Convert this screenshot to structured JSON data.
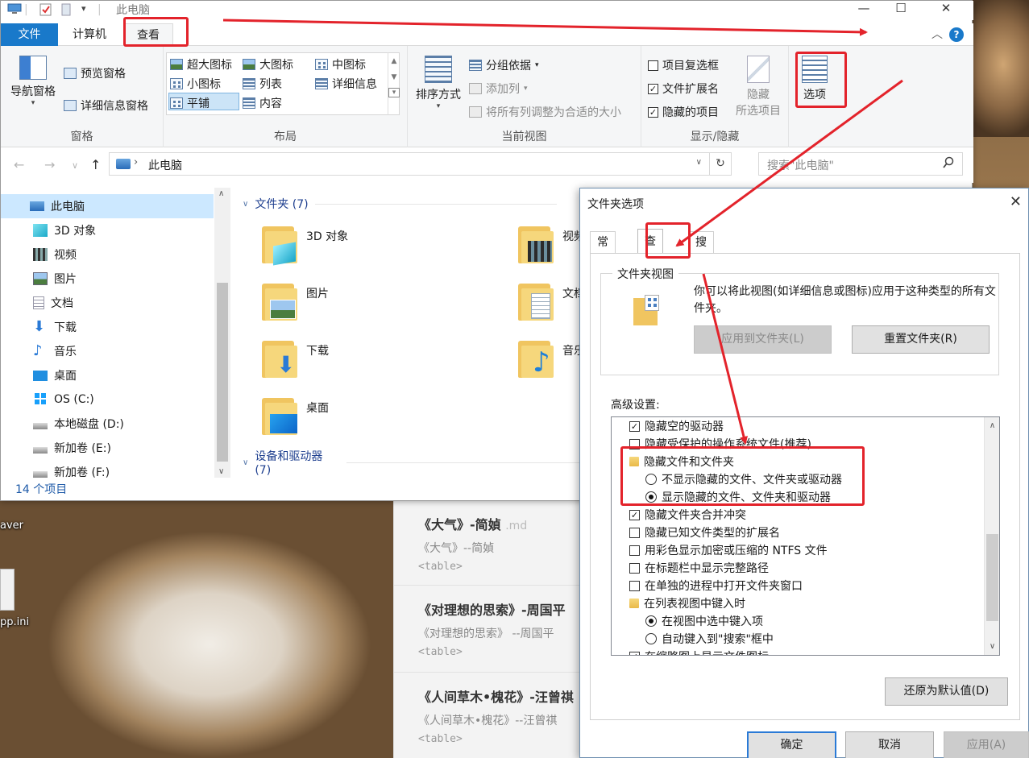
{
  "explorer": {
    "title": "此电脑",
    "tabs": {
      "file": "文件",
      "computer": "计算机",
      "view": "查看"
    },
    "ribbon": {
      "pane_group": {
        "label": "窗格",
        "nav_pane": "导航窗格",
        "preview_pane": "预览窗格",
        "details_pane": "详细信息窗格"
      },
      "layout_group": {
        "label": "布局",
        "items": [
          "超大图标",
          "大图标",
          "中图标",
          "小图标",
          "列表",
          "详细信息",
          "平铺",
          "内容"
        ]
      },
      "current_view_group": {
        "label": "当前视图",
        "sort_by": "排序方式",
        "group_by": "分组依据",
        "add_columns": "添加列",
        "size_all_columns": "将所有列调整为合适的大小"
      },
      "show_hide_group": {
        "label": "显示/隐藏",
        "item_checkboxes": "项目复选框",
        "file_extensions": "文件扩展名",
        "hidden_items": "隐藏的项目",
        "hide_selected_line1": "隐藏",
        "hide_selected_line2": "所选项目"
      },
      "options": "选项"
    },
    "address": {
      "path": "此电脑",
      "search_placeholder": "搜索\"此电脑\""
    },
    "nav_items": [
      "此电脑",
      "3D 对象",
      "视频",
      "图片",
      "文档",
      "下载",
      "音乐",
      "桌面",
      "OS (C:)",
      "本地磁盘 (D:)",
      "新加卷 (E:)",
      "新加卷 (F:)"
    ],
    "sections": {
      "folders": "文件夹 (7)",
      "devices": "设备和驱动器 (7)"
    },
    "folders": [
      "3D 对象",
      "视频",
      "图片",
      "文档",
      "下载",
      "音乐",
      "桌面"
    ],
    "status": "14 个项目"
  },
  "desktop": {
    "icon1": "aver",
    "icon2": "pp.ini"
  },
  "notes": [
    {
      "title": "《大气》-简媜",
      "ext": ".md",
      "sub": "《大气》--简媜",
      "tag": "<table>"
    },
    {
      "title": "《对理想的思索》-周国平",
      "sub": "《对理想的思索》 --周国平",
      "tag": "<table>"
    },
    {
      "title": "《人间草木•槐花》-汪曾祺",
      "sub": "《人间草木•槐花》--汪曾祺",
      "tag": "<table>"
    }
  ],
  "dialog": {
    "title": "文件夹选项",
    "tabs": [
      "常规",
      "查看",
      "搜索"
    ],
    "folder_views": {
      "legend": "文件夹视图",
      "desc": "你可以将此视图(如详细信息或图标)应用于这种类型的所有文件夹。",
      "apply_btn": "应用到文件夹(L)",
      "reset_btn": "重置文件夹(R)"
    },
    "advanced_label": "高级设置:",
    "advanced_items": {
      "hide_empty_drives": "隐藏空的驱动器",
      "hide_protected": "隐藏受保护的操作系统文件(推荐)",
      "hidden_files_folder": "隐藏文件和文件夹",
      "dont_show_hidden": "不显示隐藏的文件、文件夹或驱动器",
      "show_hidden": "显示隐藏的文件、文件夹和驱动器",
      "hide_merge_conflicts": "隐藏文件夹合并冲突",
      "hide_extensions": "隐藏已知文件类型的扩展名",
      "ntfs_color": "用彩色显示加密或压缩的 NTFS 文件",
      "full_path_title": "在标题栏中显示完整路径",
      "separate_process": "在单独的进程中打开文件夹窗口",
      "typing_in_list": "在列表视图中键入时",
      "select_typed_item": "在视图中选中键入项",
      "type_into_search": "自动键入到\"搜索\"框中",
      "thumbnails_icons": "在缩略图上显示文件图标"
    },
    "restore_defaults": "还原为默认值(D)",
    "ok": "确定",
    "cancel": "取消",
    "apply": "应用(A)"
  },
  "colors": {
    "accent": "#1979ca",
    "annotation": "#e3232b",
    "selection": "#cce8ff"
  }
}
